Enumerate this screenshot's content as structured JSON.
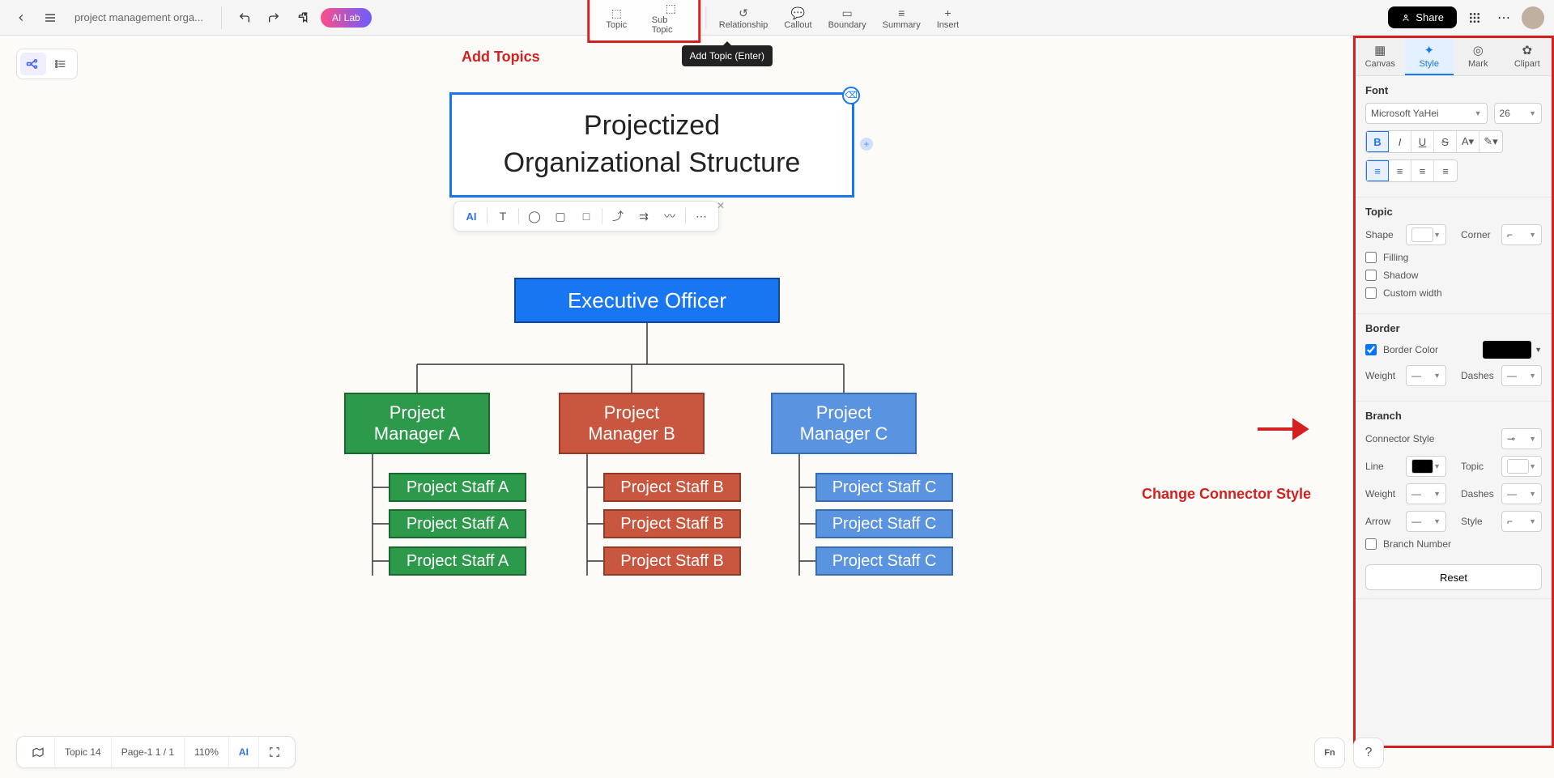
{
  "doc_title": "project management orga...",
  "ai_lab": "AI Lab",
  "share": "Share",
  "menu": {
    "topic": "Topic",
    "subtopic": "Sub Topic",
    "relationship": "Relationship",
    "callout": "Callout",
    "boundary": "Boundary",
    "summary": "Summary",
    "insert": "Insert"
  },
  "tooltip": "Add Topic (Enter)",
  "annotations": {
    "add_topics": "Add Topics",
    "change_connector": "Change Connector Style"
  },
  "main_node": "Projectized\nOrganizational Structure",
  "chart": {
    "exec": "Executive Officer",
    "mgr_a": "Project\nManager A",
    "mgr_b": "Project\nManager B",
    "mgr_c": "Project\nManager C",
    "staff": {
      "a1": "Project Staff A",
      "a2": "Project Staff A",
      "a3": "Project Staff A",
      "b1": "Project Staff B",
      "b2": "Project Staff B",
      "b3": "Project Staff B",
      "c1": "Project Staff C",
      "c2": "Project Staff C",
      "c3": "Project Staff C"
    }
  },
  "panel": {
    "tabs": {
      "canvas": "Canvas",
      "style": "Style",
      "mark": "Mark",
      "clipart": "Clipart"
    },
    "font": {
      "title": "Font",
      "family": "Microsoft YaHei",
      "size": "26"
    },
    "topic": {
      "title": "Topic",
      "shape": "Shape",
      "corner": "Corner",
      "filling": "Filling",
      "shadow": "Shadow",
      "custom_width": "Custom width"
    },
    "border": {
      "title": "Border",
      "color": "Border Color",
      "weight": "Weight",
      "dashes": "Dashes"
    },
    "branch": {
      "title": "Branch",
      "connector": "Connector Style",
      "line": "Line",
      "topic": "Topic",
      "weight": "Weight",
      "dashes": "Dashes",
      "arrow": "Arrow",
      "style": "Style",
      "number": "Branch Number"
    },
    "reset": "Reset"
  },
  "float_ai": "AI",
  "bottom": {
    "topic_count": "Topic 14",
    "page": "Page-1  1 / 1",
    "zoom": "110%",
    "ai": "AI"
  }
}
